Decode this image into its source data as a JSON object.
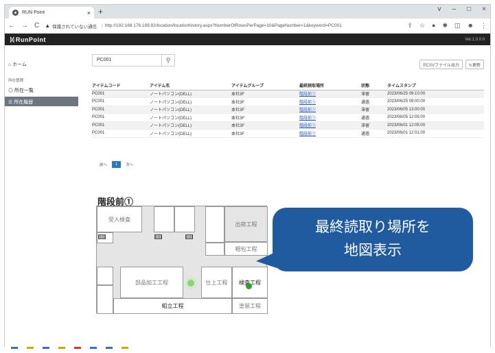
{
  "browser": {
    "tab_title": "RUN Point",
    "tab_close": "×",
    "new_tab": "+",
    "window_controls": [
      "v",
      "–",
      "□",
      "×"
    ],
    "nav_buttons": [
      "←",
      "→",
      "C"
    ],
    "insecure_label": "保護されていない通信",
    "url": "http://192.168.176.199:82/location/locationhistory.aspx?NumberOfRowsPerPage=10&PageNumber=1&keyword=PC001"
  },
  "app": {
    "logo_mark": "᛫",
    "logo_text": "RunPoint",
    "version": "Ver.1.0.0.0"
  },
  "sidebar": {
    "home": "⌂ ホーム",
    "group_label": "所在管理",
    "item_list": "◎ 所在一覧",
    "item_history": "☰ 所在履歴"
  },
  "search": {
    "value": "PC001",
    "button_icon": "⚲"
  },
  "actions": {
    "csv": "🗎CSVファイル出力",
    "refresh": "↻更新"
  },
  "table": {
    "headers": [
      "アイテムコード",
      "アイテム名",
      "アイテムグループ",
      "最終読取場所",
      "状態",
      "タイムスタンプ"
    ],
    "rows": [
      [
        "PC001",
        "ノートパソコン(DELL)",
        "本社3F",
        "階段前①",
        "滞留",
        "2023/06/25 09:10:00"
      ],
      [
        "PC001",
        "ノートパソコン(DELL)",
        "本社3F",
        "階段前①",
        "通過",
        "2023/06/25 09:00:00"
      ],
      [
        "PC001",
        "ノートパソコン(DELL)",
        "本社3F",
        "階段前①",
        "滞留",
        "2023/06/05 13:00:00"
      ],
      [
        "PC001",
        "ノートパソコン(DELL)",
        "本社3F",
        "階段前①",
        "通過",
        "2023/06/05 12:05:00"
      ],
      [
        "PC001",
        "ノートパソコン(DELL)",
        "本社3F",
        "階段前①",
        "滞留",
        "2023/06/01 12:05:00"
      ],
      [
        "PC001",
        "ノートパソコン(DELL)",
        "本社3F",
        "階段前①",
        "通過",
        "2023/06/01 12:01:00"
      ]
    ]
  },
  "pager": {
    "prev": "前へ",
    "current": "1",
    "next": "次へ"
  },
  "map": {
    "title": "階段前①",
    "rooms": {
      "receiving": "受入検査",
      "shipping": "出荷工程",
      "packing": "梱包工程",
      "parts": "部品加工工程",
      "finishing": "仕上工程",
      "inspection": "検査工程",
      "assembly": "組立工程",
      "painting": "塗装工程"
    }
  },
  "callout": {
    "line1": "最終読取り場所を",
    "line2": "地図表示"
  },
  "colors": {
    "accent": "#2a78c8",
    "callout": "#1f5b9e",
    "dot_active": "#2f9e2f",
    "dot_faded": "#8fd17a"
  }
}
